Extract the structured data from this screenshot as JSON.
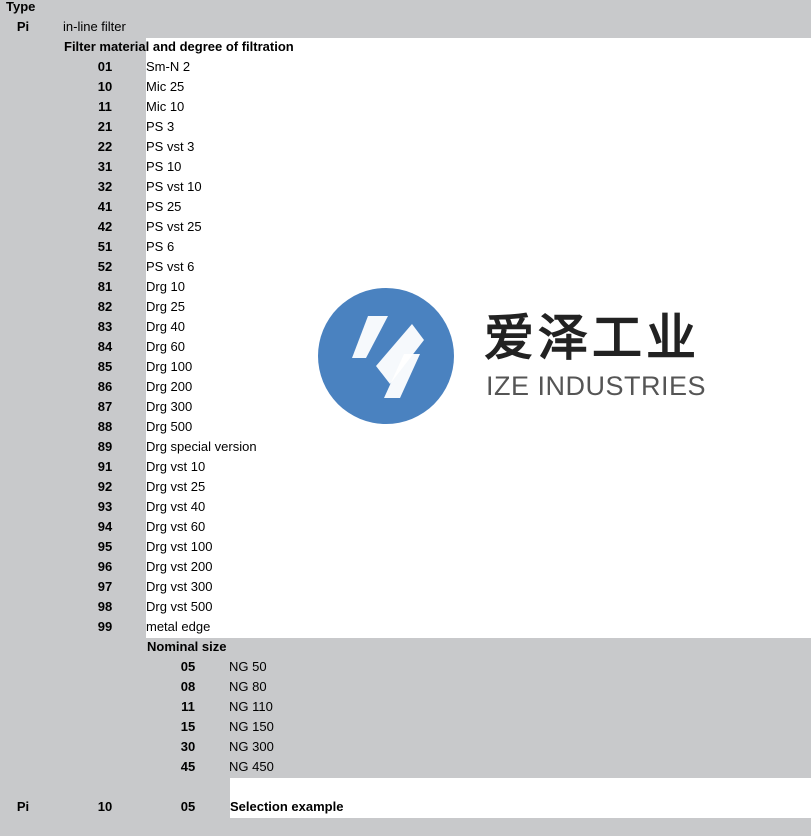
{
  "type_label": "Type",
  "type_code": "Pi",
  "type_desc": "in-line filter",
  "filter": {
    "heading": "Filter material and degree of filtration",
    "items": [
      {
        "code": "01",
        "label": "Sm-N 2"
      },
      {
        "code": "10",
        "label": "Mic 25"
      },
      {
        "code": "11",
        "label": "Mic 10"
      },
      {
        "code": "21",
        "label": "PS 3"
      },
      {
        "code": "22",
        "label": "PS vst 3"
      },
      {
        "code": "31",
        "label": "PS 10"
      },
      {
        "code": "32",
        "label": "PS vst 10"
      },
      {
        "code": "41",
        "label": "PS 25"
      },
      {
        "code": "42",
        "label": "PS vst 25"
      },
      {
        "code": "51",
        "label": "PS 6"
      },
      {
        "code": "52",
        "label": "PS vst 6"
      },
      {
        "code": "81",
        "label": "Drg 10"
      },
      {
        "code": "82",
        "label": "Drg 25"
      },
      {
        "code": "83",
        "label": "Drg 40"
      },
      {
        "code": "84",
        "label": "Drg 60"
      },
      {
        "code": "85",
        "label": "Drg 100"
      },
      {
        "code": "86",
        "label": "Drg 200"
      },
      {
        "code": "87",
        "label": "Drg 300"
      },
      {
        "code": "88",
        "label": "Drg 500"
      },
      {
        "code": "89",
        "label": "Drg special version"
      },
      {
        "code": "91",
        "label": "Drg vst 10"
      },
      {
        "code": "92",
        "label": "Drg vst 25"
      },
      {
        "code": "93",
        "label": "Drg vst 40"
      },
      {
        "code": "94",
        "label": "Drg vst 60"
      },
      {
        "code": "95",
        "label": "Drg vst 100"
      },
      {
        "code": "96",
        "label": "Drg vst 200"
      },
      {
        "code": "97",
        "label": "Drg vst 300"
      },
      {
        "code": "98",
        "label": "Drg vst 500"
      },
      {
        "code": "99",
        "label": "metal edge"
      }
    ]
  },
  "nominal": {
    "heading": "Nominal size",
    "items": [
      {
        "code": "05",
        "label": "NG 50"
      },
      {
        "code": "08",
        "label": "NG 80"
      },
      {
        "code": "11",
        "label": "NG 110"
      },
      {
        "code": "15",
        "label": "NG 150"
      },
      {
        "code": "30",
        "label": "NG 300"
      },
      {
        "code": "45",
        "label": "NG 450"
      }
    ]
  },
  "example": {
    "type_code": "Pi",
    "filter_code": "10",
    "size_code": "05",
    "label": "Selection example"
  },
  "watermark": {
    "cn": "爱泽工业",
    "en": "IZE INDUSTRIES",
    "logo_color": "#4a82c0"
  }
}
